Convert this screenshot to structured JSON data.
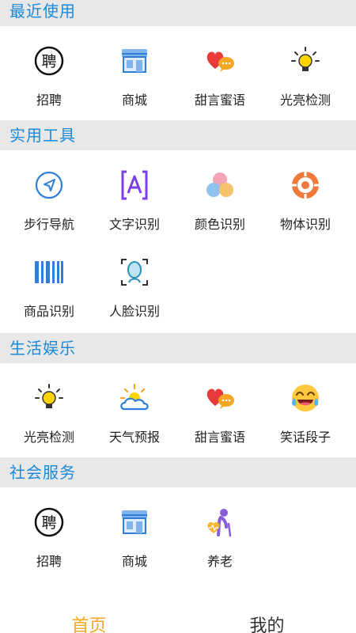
{
  "sections": [
    {
      "title": "最近使用",
      "items": [
        {
          "label": "招聘",
          "icon": "recruit-icon"
        },
        {
          "label": "商城",
          "icon": "store-icon"
        },
        {
          "label": "甜言蜜语",
          "icon": "sweet-talk-icon"
        },
        {
          "label": "光亮检测",
          "icon": "light-detect-icon"
        }
      ]
    },
    {
      "title": "实用工具",
      "items": [
        {
          "label": "步行导航",
          "icon": "navigation-icon"
        },
        {
          "label": "文字识别",
          "icon": "text-recognition-icon"
        },
        {
          "label": "颜色识别",
          "icon": "color-recognition-icon"
        },
        {
          "label": "物体识别",
          "icon": "object-recognition-icon"
        },
        {
          "label": "商品识别",
          "icon": "barcode-icon"
        },
        {
          "label": "人脸识别",
          "icon": "face-recognition-icon"
        }
      ]
    },
    {
      "title": "生活娱乐",
      "items": [
        {
          "label": "光亮检测",
          "icon": "light-detect-icon"
        },
        {
          "label": "天气预报",
          "icon": "weather-icon"
        },
        {
          "label": "甜言蜜语",
          "icon": "sweet-talk-icon"
        },
        {
          "label": "笑话段子",
          "icon": "joke-icon"
        }
      ]
    },
    {
      "title": "社会服务",
      "items": [
        {
          "label": "招聘",
          "icon": "recruit-icon"
        },
        {
          "label": "商城",
          "icon": "store-icon"
        },
        {
          "label": "养老",
          "icon": "elderly-care-icon"
        }
      ]
    }
  ],
  "tabs": {
    "home": "首页",
    "mine": "我的"
  },
  "recruit_glyph": "聘",
  "colors": {
    "accent": "#1a8ad8",
    "tab_active": "#f5a623",
    "header_bg": "#e8e8e8"
  }
}
